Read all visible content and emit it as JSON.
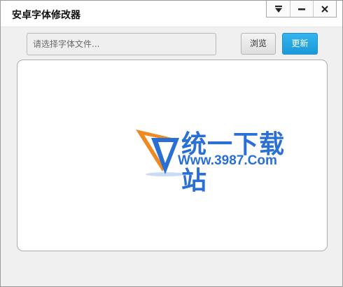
{
  "window": {
    "title": "安卓字体修改器",
    "controls": [
      {
        "name": "menu-dropdown-icon",
        "glyph": "▼"
      },
      {
        "name": "minimize-icon",
        "glyph": "—"
      },
      {
        "name": "close-icon",
        "glyph": "✕"
      }
    ]
  },
  "toolbar": {
    "file_placeholder": "请选择字体文件...",
    "browse_label": "浏览",
    "update_label": "更新"
  },
  "watermark": {
    "site_name": "统一下载站",
    "url": "Www.3987.Com"
  },
  "colors": {
    "accent": "#1a9ad9",
    "logo_blue": "#2a6fd6",
    "logo_orange": "#f08a20"
  }
}
